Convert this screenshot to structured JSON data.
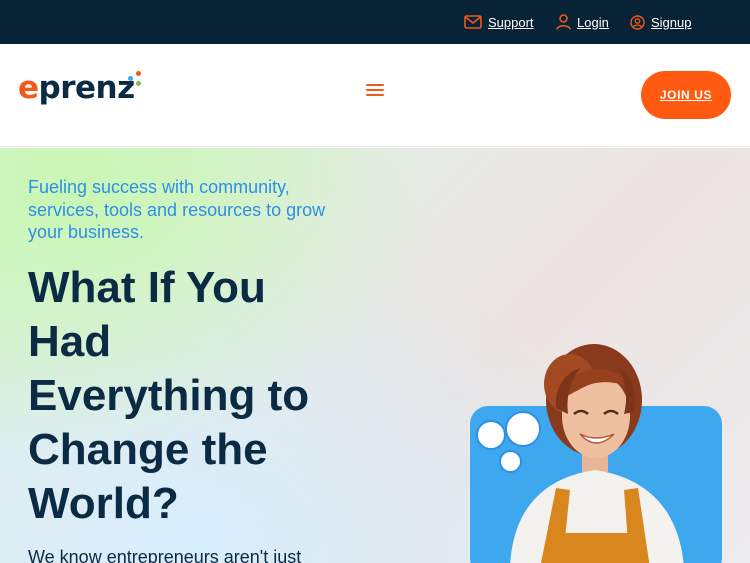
{
  "topbar": {
    "support_label": "Support",
    "login_label": "Login",
    "signup_label": "Signup",
    "icons": [
      "envelope-icon",
      "user-icon",
      "user-circle-icon"
    ]
  },
  "header": {
    "logo_first": "e",
    "logo_rest": "prenz",
    "logo_dot_colors": [
      "#f05a1a",
      "#3ea8ee",
      "#7ac143"
    ],
    "menu_icon": "hamburger-icon",
    "join_label": "JOIN US"
  },
  "hero": {
    "tagline": "Fueling success with community, services, tools and resources to grow your business.",
    "headline_lines": [
      "What If You",
      "Had",
      "Everything to",
      "Change the",
      "World?"
    ],
    "subtext": "We know entrepreneurs aren't just"
  },
  "colors": {
    "topbar_bg": "#082236",
    "brand_orange": "#ff5a0f",
    "navy": "#0b2a44",
    "accent_blue": "#2f8fe6",
    "card_blue": "#3ea8ee"
  }
}
